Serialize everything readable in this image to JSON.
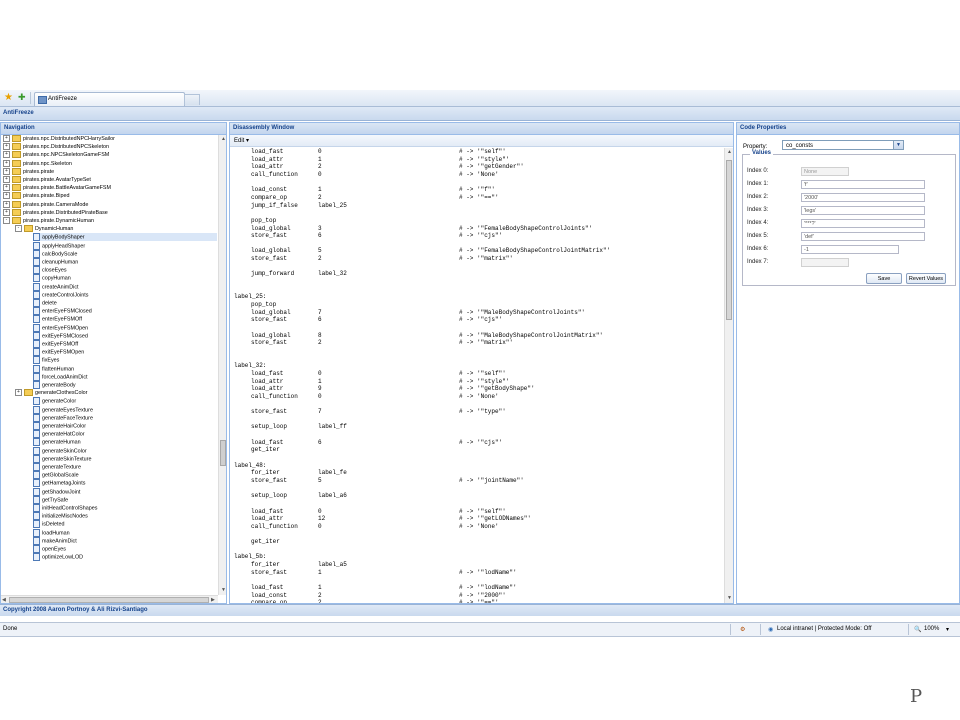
{
  "browser": {
    "tab_title": "AntiFreeze"
  },
  "app": {
    "title": "AntiFreeze",
    "copyright": "Copyright 2008 Aaron Portnoy & Ali Rizvi-Santiago"
  },
  "navigation": {
    "title": "Navigation",
    "items": [
      {
        "label": "pirates.npc.DistributedNPCHarrySailor",
        "type": "folder",
        "level": 0,
        "expander": "+"
      },
      {
        "label": "pirates.npc.DistributedNPCSkeleton",
        "type": "folder",
        "level": 0,
        "expander": "+"
      },
      {
        "label": "pirates.npc.NPCSkeletonGameFSM",
        "type": "folder",
        "level": 0,
        "expander": "+"
      },
      {
        "label": "pirates.npc.Skeleton",
        "type": "folder",
        "level": 0,
        "expander": "+"
      },
      {
        "label": "pirates.pirate",
        "type": "folder",
        "level": 0,
        "expander": "+"
      },
      {
        "label": "pirates.pirate.AvatarTypeSet",
        "type": "folder",
        "level": 0,
        "expander": "+"
      },
      {
        "label": "pirates.pirate.BattleAvatarGameFSM",
        "type": "folder",
        "level": 0,
        "expander": "+"
      },
      {
        "label": "pirates.pirate.Biped",
        "type": "folder",
        "level": 0,
        "expander": "+"
      },
      {
        "label": "pirates.pirate.CameraMode",
        "type": "folder",
        "level": 0,
        "expander": "+"
      },
      {
        "label": "pirates.pirate.DistributedPirateBase",
        "type": "folder",
        "level": 0,
        "expander": "+"
      },
      {
        "label": "pirates.pirate.DynamicHuman",
        "type": "folder",
        "level": 0,
        "expander": "-"
      },
      {
        "label": "DynamicHuman",
        "type": "folder",
        "level": 1,
        "expander": "-"
      },
      {
        "label": "applyBodyShaper",
        "type": "method",
        "level": 2,
        "selected": true
      },
      {
        "label": "applyHeadShaper",
        "type": "method",
        "level": 2
      },
      {
        "label": "calcBodyScale",
        "type": "method",
        "level": 2
      },
      {
        "label": "cleanupHuman",
        "type": "method",
        "level": 2
      },
      {
        "label": "closeEyes",
        "type": "method",
        "level": 2
      },
      {
        "label": "copyHuman",
        "type": "method",
        "level": 2
      },
      {
        "label": "createAnimDict",
        "type": "method",
        "level": 2
      },
      {
        "label": "createControlJoints",
        "type": "method",
        "level": 2
      },
      {
        "label": "delete",
        "type": "method",
        "level": 2
      },
      {
        "label": "enterEyeFSMClosed",
        "type": "method",
        "level": 2
      },
      {
        "label": "enterEyeFSMOff",
        "type": "method",
        "level": 2
      },
      {
        "label": "enterEyeFSMOpen",
        "type": "method",
        "level": 2
      },
      {
        "label": "exitEyeFSMClosed",
        "type": "method",
        "level": 2
      },
      {
        "label": "exitEyeFSMOff",
        "type": "method",
        "level": 2
      },
      {
        "label": "exitEyeFSMOpen",
        "type": "method",
        "level": 2
      },
      {
        "label": "fixEyes",
        "type": "method",
        "level": 2
      },
      {
        "label": "flattenHuman",
        "type": "method",
        "level": 2
      },
      {
        "label": "forceLoadAnimDict",
        "type": "method",
        "level": 2
      },
      {
        "label": "generateBody",
        "type": "method",
        "level": 2
      },
      {
        "label": "generateClothesColor",
        "type": "folder",
        "level": 1,
        "expander": "+"
      },
      {
        "label": "generateColor",
        "type": "method",
        "level": 2
      },
      {
        "label": "generateEyesTexture",
        "type": "method",
        "level": 2
      },
      {
        "label": "generateFaceTexture",
        "type": "method",
        "level": 2
      },
      {
        "label": "generateHairColor",
        "type": "method",
        "level": 2
      },
      {
        "label": "generateHatColor",
        "type": "method",
        "level": 2
      },
      {
        "label": "generateHuman",
        "type": "method",
        "level": 2
      },
      {
        "label": "generateSkinColor",
        "type": "method",
        "level": 2
      },
      {
        "label": "generateSkinTexture",
        "type": "method",
        "level": 2
      },
      {
        "label": "generateTexture",
        "type": "method",
        "level": 2
      },
      {
        "label": "getGlobalScale",
        "type": "method",
        "level": 2
      },
      {
        "label": "getHametagJoints",
        "type": "method",
        "level": 2
      },
      {
        "label": "getShadowJoint",
        "type": "method",
        "level": 2
      },
      {
        "label": "getTrySafe",
        "type": "method",
        "level": 2
      },
      {
        "label": "initHeadControlShapes",
        "type": "method",
        "level": 2
      },
      {
        "label": "initializeMiscNodes",
        "type": "method",
        "level": 2
      },
      {
        "label": "isDeleted",
        "type": "method",
        "level": 2
      },
      {
        "label": "loadHuman",
        "type": "method",
        "level": 2
      },
      {
        "label": "makeAnimDict",
        "type": "method",
        "level": 2
      },
      {
        "label": "openEyes",
        "type": "method",
        "level": 2
      },
      {
        "label": "optimizeLowLOD",
        "type": "method",
        "level": 2
      }
    ]
  },
  "disassembly": {
    "title": "Disassembly Window",
    "edit_label": "Edit ▾",
    "lines": [
      {
        "op": "load_fast",
        "arg": "0",
        "comment": "# -> '\"self\"'"
      },
      {
        "op": "load_attr",
        "arg": "1",
        "comment": "# -> '\"style\"'"
      },
      {
        "op": "load_attr",
        "arg": "2",
        "comment": "# -> '\"getGender\"'"
      },
      {
        "op": "call_function",
        "arg": "0",
        "comment": "# -> 'None'"
      },
      {
        "blank": true
      },
      {
        "op": "load_const",
        "arg": "1",
        "comment": "# -> '\"f\"'"
      },
      {
        "op": "compare_op",
        "arg": "2",
        "comment": "# -> '\"==\"'"
      },
      {
        "op": "jump_if_false",
        "arg": "label_25",
        "comment": ""
      },
      {
        "blank": true
      },
      {
        "op": "pop_top",
        "arg": "",
        "comment": ""
      },
      {
        "op": "load_global",
        "arg": "3",
        "comment": "# -> '\"FemaleBodyShapeControlJoints\"'"
      },
      {
        "op": "store_fast",
        "arg": "6",
        "comment": "# -> '\"cjs\"'"
      },
      {
        "blank": true
      },
      {
        "op": "load_global",
        "arg": "5",
        "comment": "# -> '\"FemaleBodyShapeControlJointMatrix\"'"
      },
      {
        "op": "store_fast",
        "arg": "2",
        "comment": "# -> '\"matrix\"'"
      },
      {
        "blank": true
      },
      {
        "op": "jump_forward",
        "arg": "label_32",
        "comment": ""
      },
      {
        "blank": true
      },
      {
        "blank": true
      },
      {
        "label": "label_25:"
      },
      {
        "op": "pop_top",
        "arg": "",
        "comment": ""
      },
      {
        "op": "load_global",
        "arg": "7",
        "comment": "# -> '\"MaleBodyShapeControlJoints\"'"
      },
      {
        "op": "store_fast",
        "arg": "6",
        "comment": "# -> '\"cjs\"'"
      },
      {
        "blank": true
      },
      {
        "op": "load_global",
        "arg": "8",
        "comment": "# -> '\"MaleBodyShapeControlJointMatrix\"'"
      },
      {
        "op": "store_fast",
        "arg": "2",
        "comment": "# -> '\"matrix\"'"
      },
      {
        "blank": true
      },
      {
        "blank": true
      },
      {
        "label": "label_32:"
      },
      {
        "op": "load_fast",
        "arg": "0",
        "comment": "# -> '\"self\"'"
      },
      {
        "op": "load_attr",
        "arg": "1",
        "comment": "# -> '\"style\"'"
      },
      {
        "op": "load_attr",
        "arg": "9",
        "comment": "# -> '\"getBodyShape\"'"
      },
      {
        "op": "call_function",
        "arg": "0",
        "comment": "# -> 'None'"
      },
      {
        "blank": true
      },
      {
        "op": "store_fast",
        "arg": "7",
        "comment": "# -> '\"type\"'"
      },
      {
        "blank": true
      },
      {
        "op": "setup_loop",
        "arg": "label_ff",
        "comment": ""
      },
      {
        "blank": true
      },
      {
        "op": "load_fast",
        "arg": "6",
        "comment": "# -> '\"cjs\"'"
      },
      {
        "op": "get_iter",
        "arg": "",
        "comment": ""
      },
      {
        "blank": true
      },
      {
        "label": "label_48:"
      },
      {
        "op": "for_iter",
        "arg": "label_fe",
        "comment": ""
      },
      {
        "op": "store_fast",
        "arg": "5",
        "comment": "# -> '\"jointName\"'"
      },
      {
        "blank": true
      },
      {
        "op": "setup_loop",
        "arg": "label_a6",
        "comment": ""
      },
      {
        "blank": true
      },
      {
        "op": "load_fast",
        "arg": "0",
        "comment": "# -> '\"self\"'"
      },
      {
        "op": "load_attr",
        "arg": "12",
        "comment": "# -> '\"getLODNames\"'"
      },
      {
        "op": "call_function",
        "arg": "0",
        "comment": "# -> 'None'"
      },
      {
        "blank": true
      },
      {
        "op": "get_iter",
        "arg": "",
        "comment": ""
      },
      {
        "blank": true
      },
      {
        "label": "label_5b:"
      },
      {
        "op": "for_iter",
        "arg": "label_a5",
        "comment": ""
      },
      {
        "op": "store_fast",
        "arg": "1",
        "comment": "# -> '\"lodName\"'"
      },
      {
        "blank": true
      },
      {
        "op": "load_fast",
        "arg": "1",
        "comment": "# -> '\"lodName\"'"
      },
      {
        "op": "load_const",
        "arg": "2",
        "comment": "# -> '\"2000\"'"
      },
      {
        "op": "compare_op",
        "arg": "2",
        "comment": "# -> '\"==\"'"
      }
    ]
  },
  "code_properties": {
    "title": "Code Properties",
    "property_label": "Property:",
    "property_value": "co_consts",
    "values_legend": "Values",
    "entries": [
      {
        "label": "Index 0:",
        "value": "None",
        "disabled": true
      },
      {
        "label": "Index 1:",
        "value": "'f'",
        "disabled": false
      },
      {
        "label": "Index 2:",
        "value": "'2000'",
        "disabled": false
      },
      {
        "label": "Index 3:",
        "value": "'legs'",
        "disabled": false
      },
      {
        "label": "Index 4:",
        "value": "'***?'",
        "disabled": false
      },
      {
        "label": "Index 5:",
        "value": "'def'",
        "disabled": false
      },
      {
        "label": "Index 6:",
        "value": "-1",
        "disabled": false
      },
      {
        "label": "Index 7:",
        "value": "",
        "disabled": true
      }
    ],
    "save_label": "Save",
    "revert_label": "Revert Values"
  },
  "status": {
    "left": "Done",
    "zone": "Local intranet | Protected Mode: Off",
    "zoom": "100%"
  },
  "slide_mark": "P",
  "colors": {
    "header_text": "#15428b",
    "panel_border": "#99bbe8",
    "selection": "#d9e6f7"
  }
}
